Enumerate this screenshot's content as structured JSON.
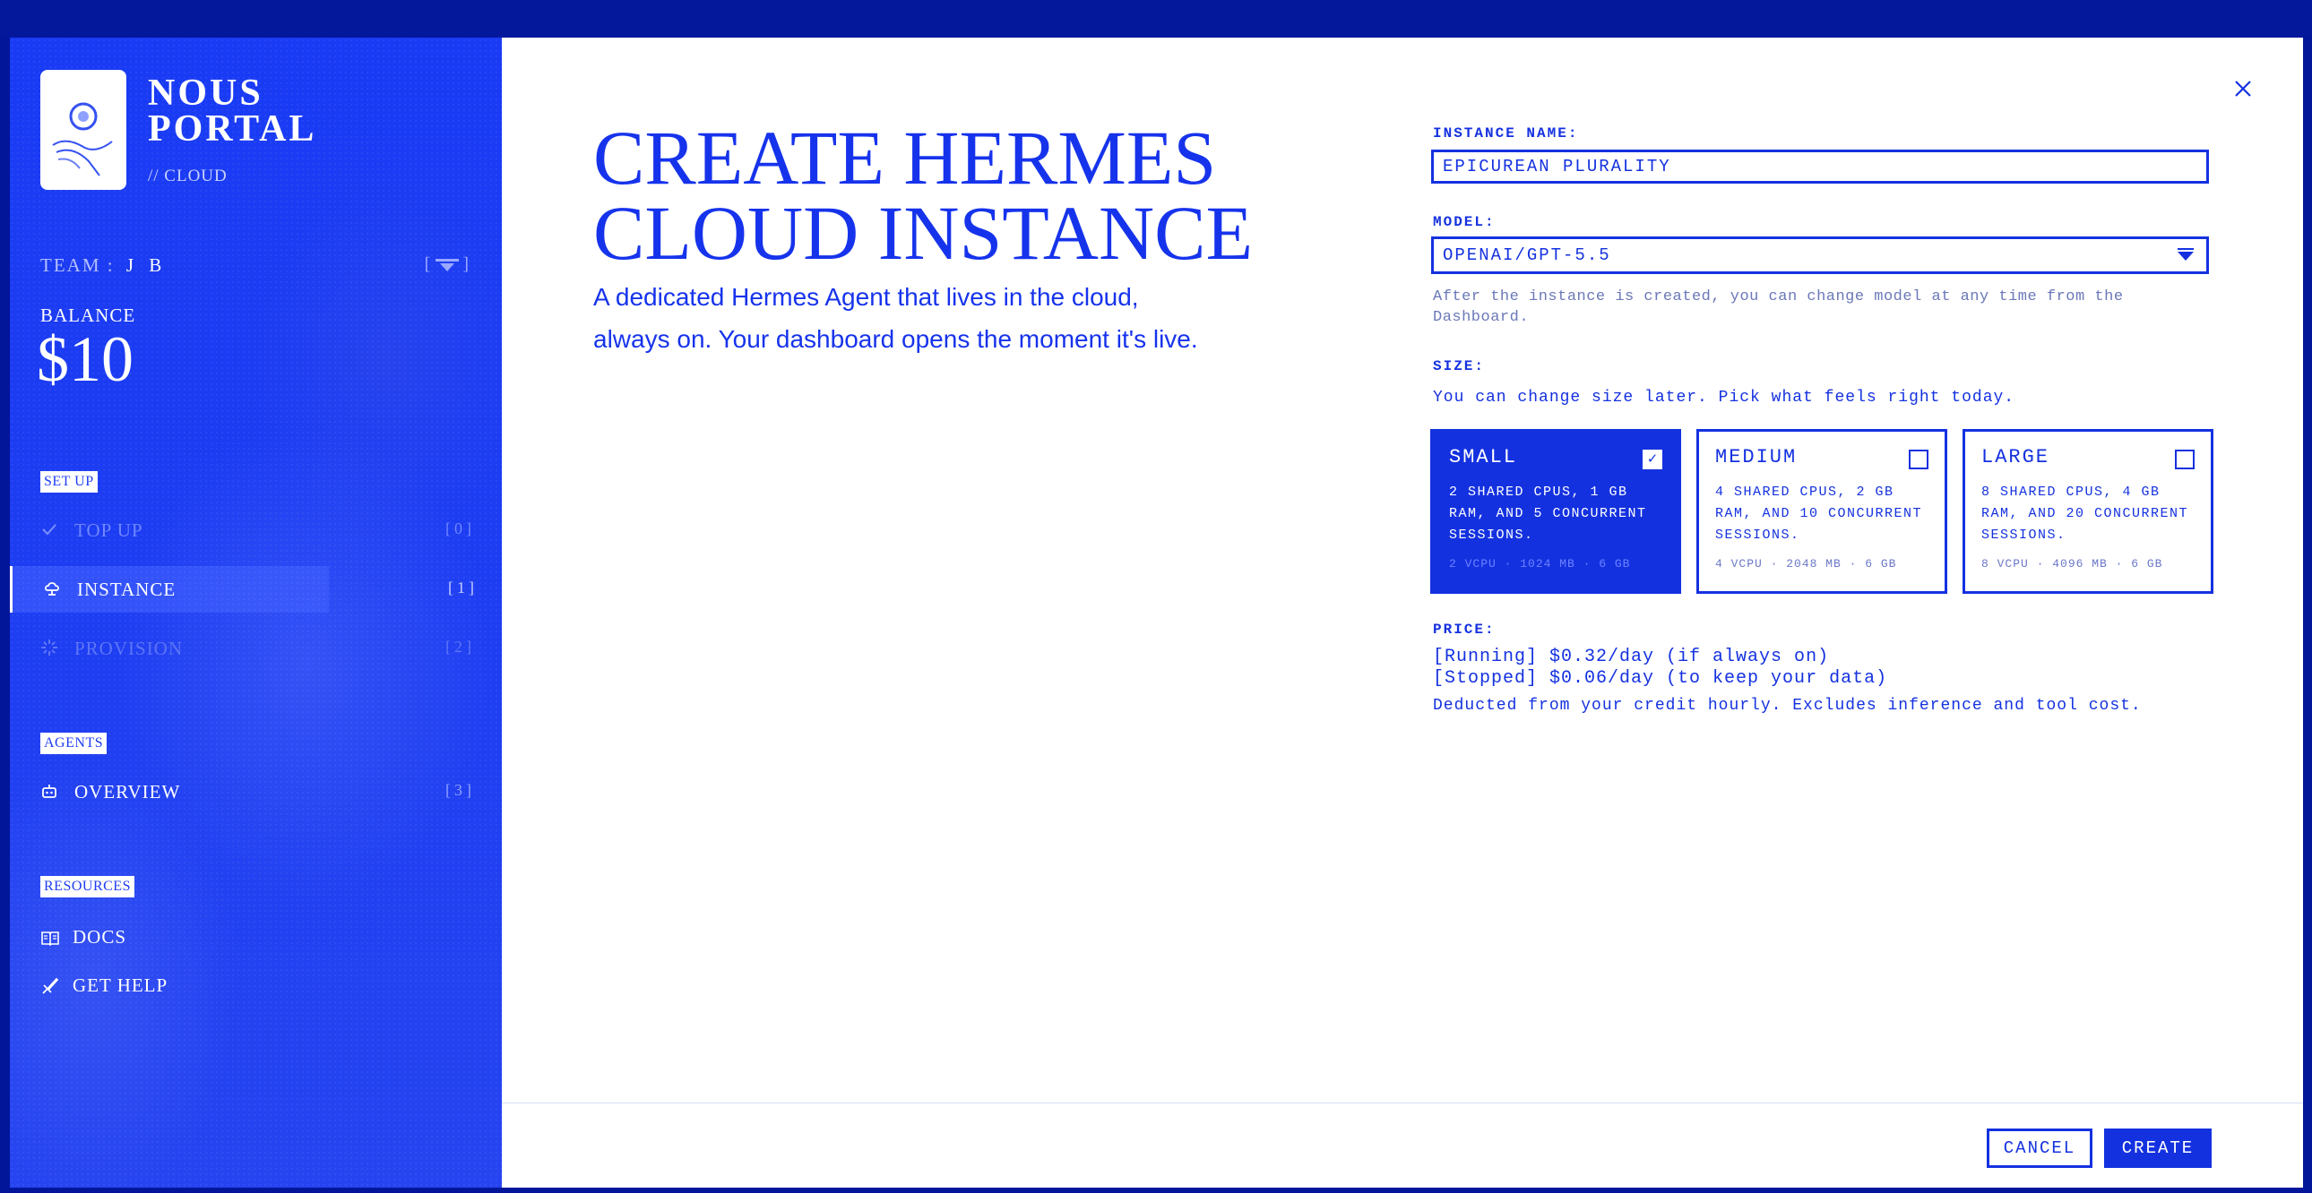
{
  "sidebar": {
    "brand_title": "NOUS PORTAL",
    "brand_sub": "// CLOUD",
    "team_label": "TEAM :",
    "team_value": "J B",
    "balance_label": "BALANCE",
    "balance_value": "$10",
    "sections": {
      "setup": "SET UP",
      "agents": "AGENTS",
      "resources": "RESOURCES"
    },
    "steps": [
      {
        "label": "TOP UP",
        "num": "[0]",
        "icon": "check-icon",
        "state": "done"
      },
      {
        "label": "INSTANCE",
        "num": "[1]",
        "icon": "cloud-instance-icon",
        "state": "active"
      },
      {
        "label": "PROVISION",
        "num": "[2]",
        "icon": "spinner-icon",
        "state": "todo"
      }
    ],
    "agents_items": [
      {
        "label": "OVERVIEW",
        "num": "[3]",
        "icon": "robot-icon"
      }
    ],
    "resources_items": [
      {
        "label": "DOCS",
        "icon": "book-icon"
      },
      {
        "label": "GET HELP",
        "icon": "pen-nib-icon"
      }
    ]
  },
  "main": {
    "title_line1": "CREATE HERMES",
    "title_line2": "CLOUD INSTANCE",
    "description": "A dedicated Hermes Agent that lives in the cloud, always on. Your dashboard opens the moment it's live.",
    "instance_name_label": "INSTANCE NAME:",
    "instance_name_value": "EPICUREAN PLURALITY",
    "model_label": "MODEL:",
    "model_value": "OPENAI/GPT-5.5",
    "model_help": "After the instance is created, you can change model at any time from the Dashboard.",
    "size_label": "SIZE:",
    "size_hint": "You can change size later. Pick what feels right today.",
    "sizes": [
      {
        "name": "SMALL",
        "desc": "2 SHARED CPUS, 1 GB RAM, AND 5 CONCURRENT SESSIONS.",
        "specs": "2 VCPU · 1024 MB · 6 GB",
        "selected": true
      },
      {
        "name": "MEDIUM",
        "desc": "4 SHARED CPUS, 2 GB RAM, AND 10 CONCURRENT SESSIONS.",
        "specs": "4 VCPU · 2048 MB · 6 GB",
        "selected": false
      },
      {
        "name": "LARGE",
        "desc": "8 SHARED CPUS, 4 GB RAM, AND 20 CONCURRENT SESSIONS.",
        "specs": "8 VCPU · 4096 MB · 6 GB",
        "selected": false
      }
    ],
    "price_label": "PRICE:",
    "price_running": "[Running] $0.32/day (if always on)",
    "price_stopped": "[Stopped] $0.06/day (to keep your data)",
    "price_note": "Deducted from your credit hourly. Excludes inference and tool cost.",
    "cancel_label": "CANCEL",
    "create_label": "CREATE",
    "close_icon": "close-icon"
  },
  "colors": {
    "accent": "#1431e0",
    "sidebar_bg": "#1d3df2",
    "frame_bg": "#02169a"
  }
}
